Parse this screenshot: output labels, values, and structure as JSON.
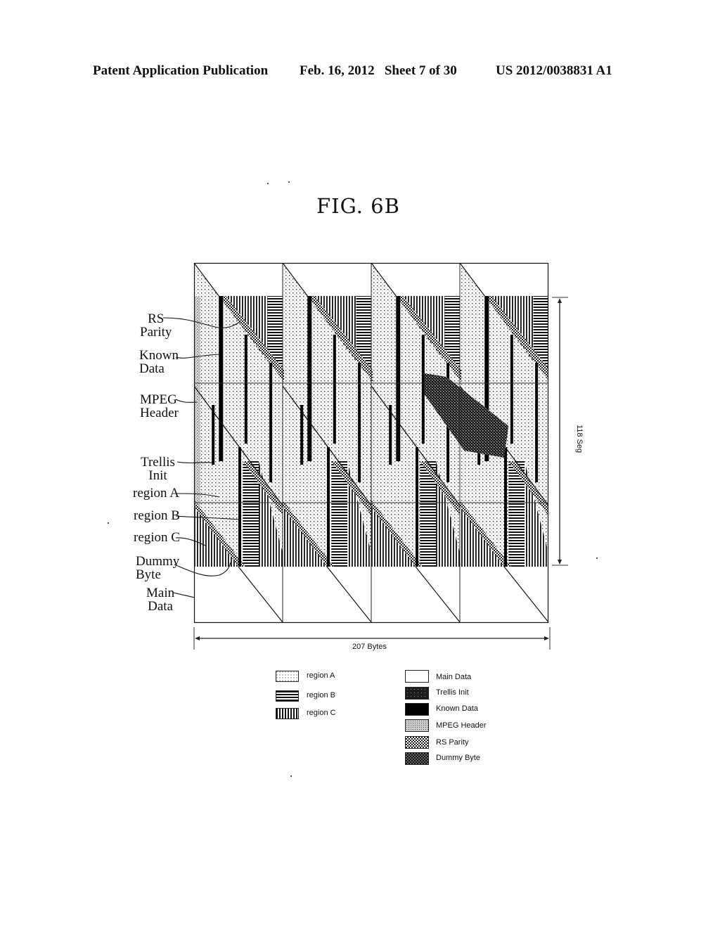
{
  "header": {
    "left": "Patent Application Publication",
    "middle": "Feb. 16, 2012   Sheet 7 of 30",
    "right": "US 2012/0038831 A1"
  },
  "figure": {
    "title": "FIG. 6B",
    "width_label": "207 Bytes",
    "height_label": "118 Seg",
    "column_count": 4,
    "callouts": [
      {
        "id": "rs-parity",
        "text": [
          "RS",
          "Parity"
        ]
      },
      {
        "id": "known-data",
        "text": [
          "Known",
          "Data"
        ]
      },
      {
        "id": "mpeg-header",
        "text": [
          "MPEG",
          "Header"
        ]
      },
      {
        "id": "trellis-init",
        "text": [
          "Trellis",
          "Init"
        ]
      },
      {
        "id": "region-a",
        "text": [
          "region A"
        ]
      },
      {
        "id": "region-b",
        "text": [
          "region B"
        ]
      },
      {
        "id": "region-c",
        "text": [
          "region C"
        ]
      },
      {
        "id": "dummy-byte",
        "text": [
          "Dummy",
          "Byte"
        ]
      },
      {
        "id": "main-data",
        "text": [
          "Main",
          "Data"
        ]
      }
    ]
  },
  "legend": {
    "left": [
      {
        "label": "region A",
        "pattern": "dots"
      },
      {
        "label": "region B",
        "pattern": "horizontal-lines"
      },
      {
        "label": "region C",
        "pattern": "vertical-lines"
      }
    ],
    "right": [
      {
        "label": "Main Data",
        "pattern": "white"
      },
      {
        "label": "Trellis Init",
        "pattern": "dark-speckle"
      },
      {
        "label": "Known Data",
        "pattern": "solid-black"
      },
      {
        "label": "MPEG Header",
        "pattern": "light-speckle"
      },
      {
        "label": "RS Parity",
        "pattern": "checker"
      },
      {
        "label": "Dummy Byte",
        "pattern": "dark-checker"
      }
    ]
  }
}
